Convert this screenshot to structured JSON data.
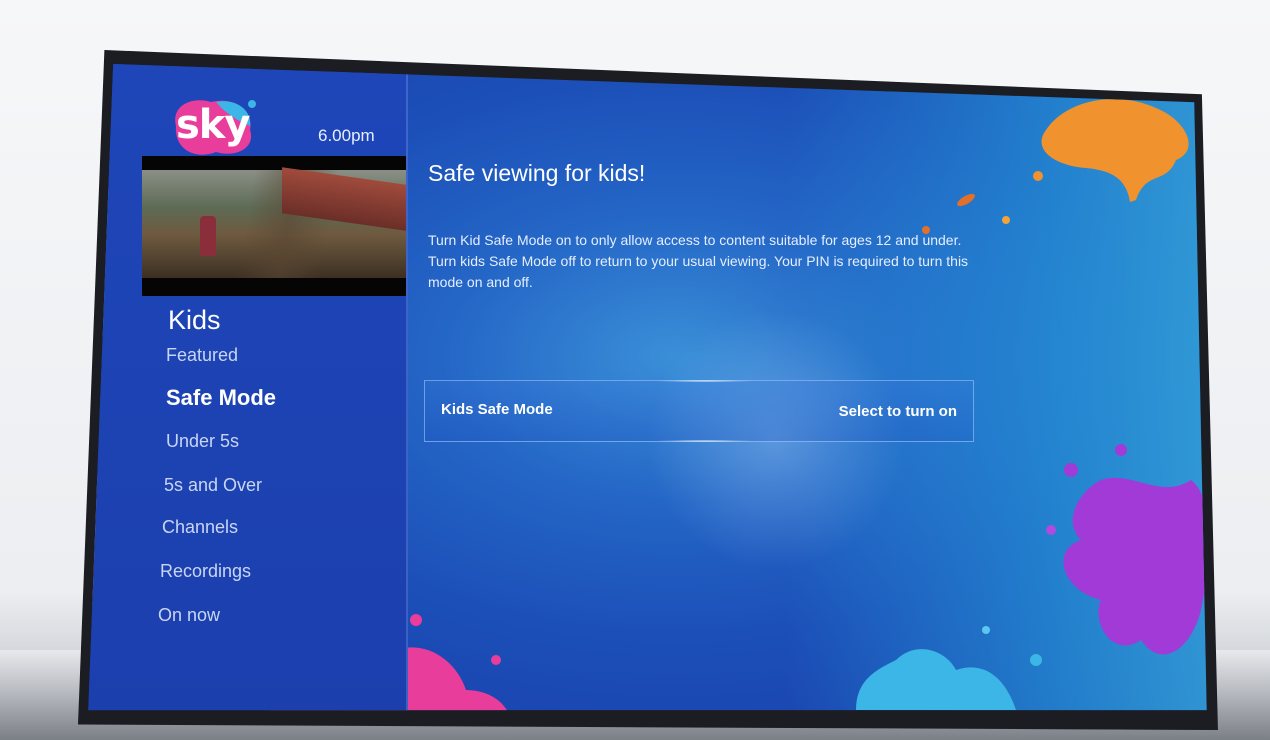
{
  "header": {
    "logo_text": "sky",
    "time": "6.00pm"
  },
  "sidebar": {
    "section_title": "Kids",
    "items": [
      {
        "label": "Featured"
      },
      {
        "label": "Safe Mode"
      },
      {
        "label": "Under 5s"
      },
      {
        "label": "5s and Over"
      },
      {
        "label": "Channels"
      },
      {
        "label": "Recordings"
      },
      {
        "label": "On now"
      }
    ],
    "active_item": "Safe Mode"
  },
  "main": {
    "title": "Safe viewing for kids!",
    "description": "Turn Kid Safe Mode on to only allow access to content suitable for ages 12 and under. Turn kids Safe Mode off to return to your usual viewing. Your PIN is required to turn this mode on and off.",
    "safe_mode": {
      "label": "Kids Safe Mode",
      "action": "Select to turn on"
    }
  },
  "colors": {
    "screen_blue": "#1c4fb8",
    "splat_orange": "#f0922e",
    "splat_pink": "#e83d9a",
    "splat_purple": "#a13ad6",
    "splat_cyan": "#3bb6e6"
  }
}
